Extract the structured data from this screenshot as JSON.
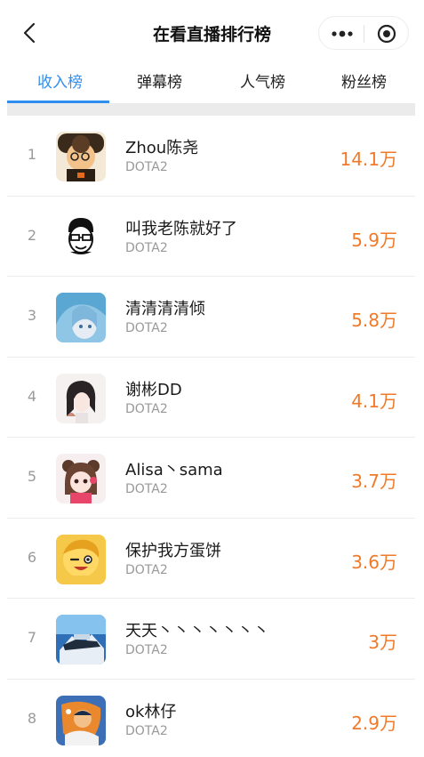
{
  "nav": {
    "title": "在看直播排行榜",
    "back_icon": "chevron-left-icon",
    "more_icon": "more-dots-icon",
    "close_icon": "target-close-icon"
  },
  "tabs": [
    {
      "label": "收入榜",
      "active": true
    },
    {
      "label": "弹幕榜",
      "active": false
    },
    {
      "label": "人气榜",
      "active": false
    },
    {
      "label": "粉丝榜",
      "active": false
    }
  ],
  "colors": {
    "accent": "#2f8ef0",
    "amount": "#f07a2a",
    "rank": "#9a9a9a",
    "subtext": "#999999"
  },
  "ranking": [
    {
      "rank": "1",
      "name": "Zhou陈尧",
      "game": "DOTA2",
      "amount": "14.1万"
    },
    {
      "rank": "2",
      "name": "叫我老陈就好了",
      "game": "DOTA2",
      "amount": "5.9万"
    },
    {
      "rank": "3",
      "name": "清清清清倾",
      "game": "DOTA2",
      "amount": "5.8万"
    },
    {
      "rank": "4",
      "name": "谢彬DD",
      "game": "DOTA2",
      "amount": "4.1万"
    },
    {
      "rank": "5",
      "name": "Alisa丶sama",
      "game": "DOTA2",
      "amount": "3.7万"
    },
    {
      "rank": "6",
      "name": "保护我方蛋饼",
      "game": "DOTA2",
      "amount": "3.6万"
    },
    {
      "rank": "7",
      "name": "天天丶丶丶丶丶丶丶",
      "game": "DOTA2",
      "amount": "3万"
    },
    {
      "rank": "8",
      "name": "ok林仔",
      "game": "DOTA2",
      "amount": "2.9万"
    }
  ]
}
